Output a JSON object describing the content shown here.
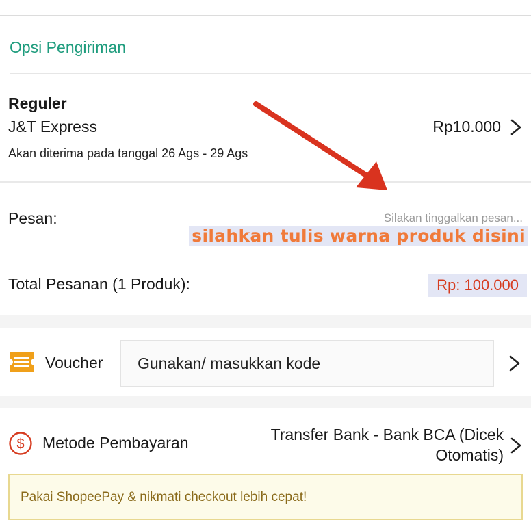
{
  "shipping": {
    "section_title": "Opsi Pengiriman",
    "service": "Reguler",
    "courier": "J&T Express",
    "estimate": "Akan diterima pada tanggal 26 Ags - 29 Ags",
    "price": "Rp10.000"
  },
  "message": {
    "label": "Pesan:",
    "placeholder": "Silakan tinggalkan pesan...",
    "annotation": "silahkan tulis warna produk disini"
  },
  "order_total": {
    "label": "Total Pesanan (1 Produk):",
    "value": "Rp: 100.000"
  },
  "voucher": {
    "label": "Voucher",
    "input_value": "Gunakan/ masukkan kode"
  },
  "payment": {
    "label": "Metode Pembayaran",
    "value": "Transfer Bank - Bank BCA (Dicek Otomatis)"
  },
  "promo": {
    "text": "Pakai ShopeePay & nikmati checkout lebih cepat!"
  },
  "icons": {
    "voucher": "voucher-ticket-icon",
    "payment": "dollar-circle-icon",
    "chevron": "chevron-right-icon",
    "annotation_arrow": "red-arrow-icon"
  },
  "colors": {
    "accent_green": "#1e9c7d",
    "price_red": "#d63b1f",
    "annotation_orange": "#f07a3a",
    "voucher_orange": "#f0a01a",
    "arrow_red": "#d9331f"
  }
}
